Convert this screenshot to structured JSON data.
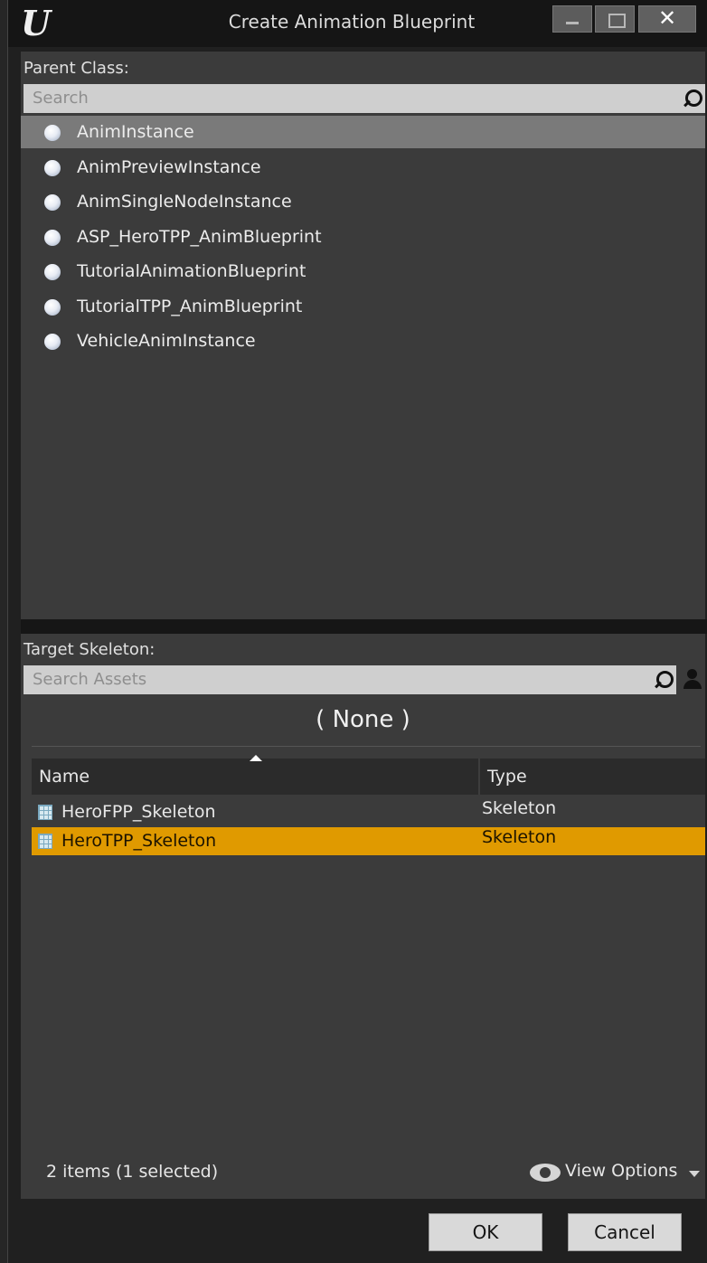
{
  "window": {
    "title": "Create Animation Blueprint",
    "logo_text": "U",
    "close_glyph": "✕"
  },
  "parent_class": {
    "label": "Parent Class:",
    "search_placeholder": "Search",
    "items": [
      {
        "label": "AnimInstance",
        "selected": true
      },
      {
        "label": "AnimPreviewInstance",
        "selected": false
      },
      {
        "label": "AnimSingleNodeInstance",
        "selected": false
      },
      {
        "label": "ASP_HeroTPP_AnimBlueprint",
        "selected": false
      },
      {
        "label": "TutorialAnimationBlueprint",
        "selected": false
      },
      {
        "label": "TutorialTPP_AnimBlueprint",
        "selected": false
      },
      {
        "label": "VehicleAnimInstance",
        "selected": false
      }
    ]
  },
  "target_skeleton": {
    "label": "Target Skeleton:",
    "search_placeholder": "Search Assets",
    "current": "( None )",
    "columns": {
      "name": "Name",
      "type": "Type"
    },
    "rows": [
      {
        "name": "HeroFPP_Skeleton",
        "type": "Skeleton",
        "selected": false
      },
      {
        "name": "HeroTPP_Skeleton",
        "type": "Skeleton",
        "selected": true
      }
    ],
    "status": "2 items (1 selected)",
    "view_options": "View Options"
  },
  "footer": {
    "ok_label": "OK",
    "cancel_label": "Cancel"
  },
  "colors": {
    "selection_gold": "#e09a00",
    "panel_bg": "#3b3b3b",
    "title_bg": "#151515"
  },
  "icons": [
    "search-icon",
    "person-icon",
    "eye-icon",
    "class-sphere-icon",
    "skeleton-asset-icon",
    "unreal-logo-icon"
  ]
}
